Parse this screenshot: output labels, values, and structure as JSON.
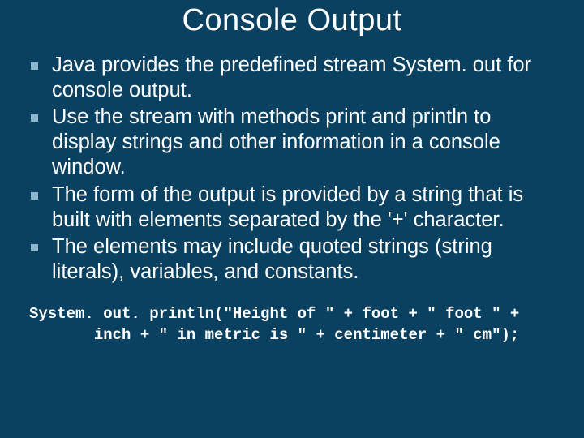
{
  "title": "Console Output",
  "bullets": [
    "Java provides the predefined stream System. out for console output.",
    "Use the stream with methods print and println to display strings and other information in a console window.",
    "The form of the output is provided by a string that is built with elements separated by the '+' character.",
    "The elements may include quoted strings (string literals), variables, and constants."
  ],
  "code": "System. out. println(\"Height of \" + foot + \" foot \" +\n       inch + \" in metric is \" + centimeter + \" cm\");"
}
